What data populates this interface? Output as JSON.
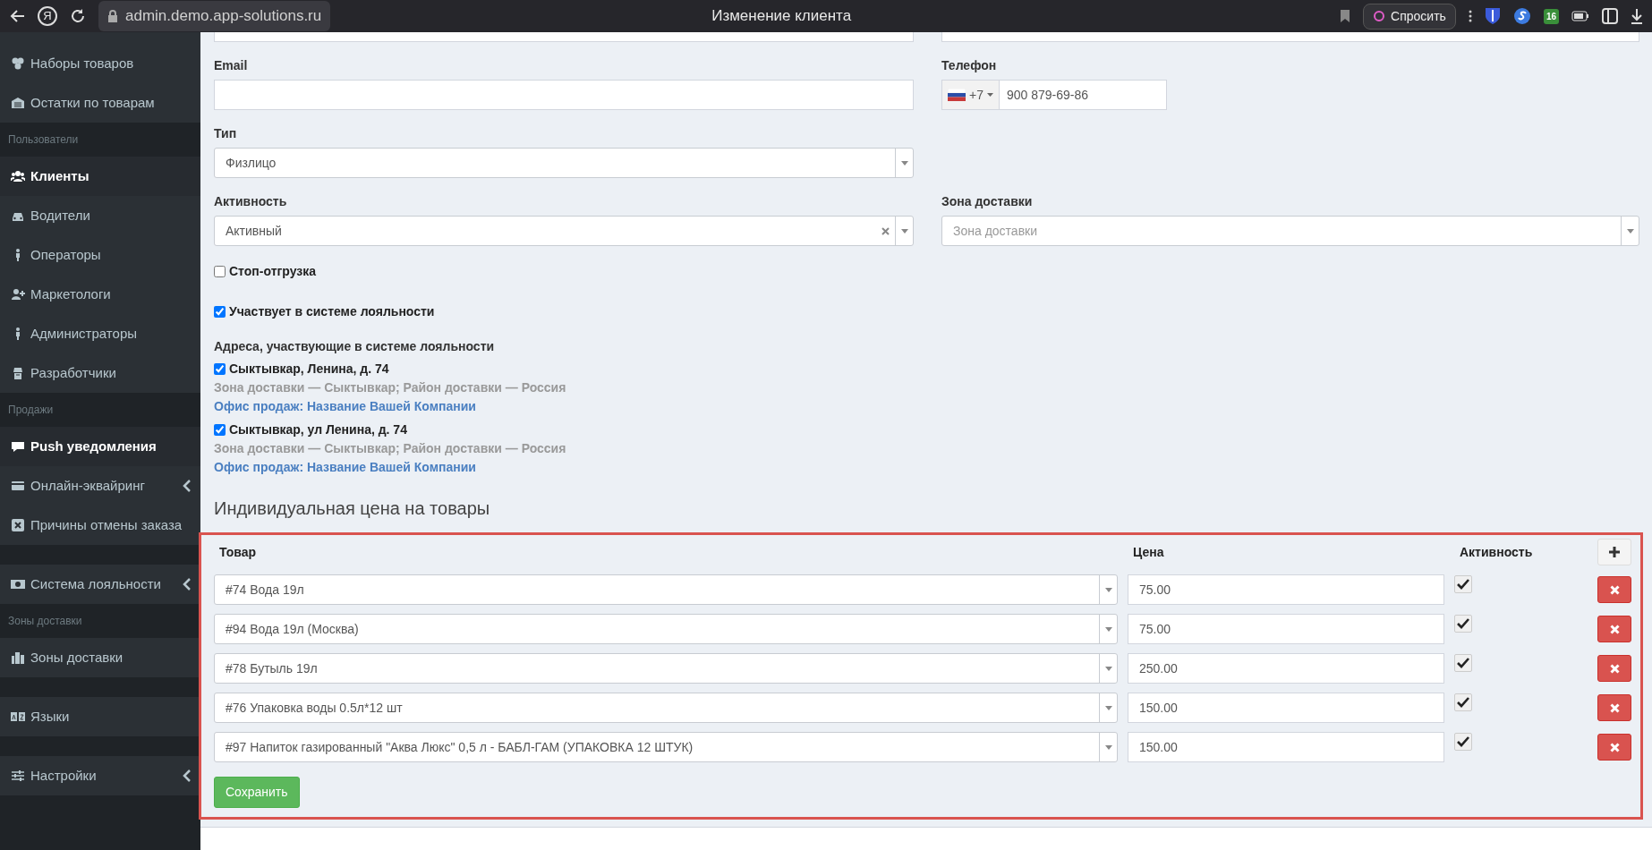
{
  "browser": {
    "logo_letter": "Я",
    "url": "admin.demo.app-solutions.ru",
    "title": "Изменение клиента",
    "ask_button": "Спросить",
    "extension_badge": "16"
  },
  "sidebar": {
    "items": [
      {
        "kind": "item",
        "label": "Наборы товаров",
        "selected": false,
        "has_submenu": false
      },
      {
        "kind": "item",
        "label": "Остатки по товарам",
        "selected": false,
        "has_submenu": false
      },
      {
        "kind": "header",
        "label": "Пользователи"
      },
      {
        "kind": "item",
        "label": "Клиенты",
        "selected": true,
        "has_submenu": false
      },
      {
        "kind": "item",
        "label": "Водители",
        "selected": false,
        "has_submenu": false
      },
      {
        "kind": "item",
        "label": "Операторы",
        "selected": false,
        "has_submenu": false
      },
      {
        "kind": "item",
        "label": "Маркетологи",
        "selected": false,
        "has_submenu": false
      },
      {
        "kind": "item",
        "label": "Администраторы",
        "selected": false,
        "has_submenu": false
      },
      {
        "kind": "item",
        "label": "Разработчики",
        "selected": false,
        "has_submenu": false
      },
      {
        "kind": "header",
        "label": "Продажи"
      },
      {
        "kind": "item",
        "label": "Push уведомления",
        "selected": true,
        "has_submenu": false
      },
      {
        "kind": "item",
        "label": "Онлайн-эквайринг",
        "selected": false,
        "has_submenu": true
      },
      {
        "kind": "item",
        "label": "Причины отмены заказа",
        "selected": false,
        "has_submenu": false
      },
      {
        "kind": "spacer"
      },
      {
        "kind": "item",
        "label": "Система лояльности",
        "selected": false,
        "has_submenu": true
      },
      {
        "kind": "header",
        "label": "Зоны доставки"
      },
      {
        "kind": "item",
        "label": "Зоны доставки",
        "selected": false,
        "has_submenu": false
      },
      {
        "kind": "spacer"
      },
      {
        "kind": "item",
        "label": "Языки",
        "selected": false,
        "has_submenu": false
      },
      {
        "kind": "spacer"
      },
      {
        "kind": "item",
        "label": "Настройки",
        "selected": false,
        "has_submenu": true
      }
    ]
  },
  "form": {
    "email": {
      "label": "Email"
    },
    "phone": {
      "label": "Телефон",
      "country_code": "+7",
      "value": "900 879-69-86"
    },
    "type": {
      "label": "Тип",
      "value": "Физлицо"
    },
    "activity": {
      "label": "Активность",
      "value": "Активный",
      "clearable": true
    },
    "delivery_zone": {
      "label": "Зона доставки",
      "placeholder": "Зона доставки"
    },
    "checkboxes": [
      {
        "label": "Стоп-отгрузка",
        "checked": false
      },
      {
        "label": "Участвует в системе лояльности",
        "checked": true
      }
    ],
    "loyalty_addresses": {
      "title": "Адреса, участвующие в системе лояльности",
      "items": [
        {
          "address": "Сыктывкар, Ленина, д. 74",
          "checked": true,
          "details": "Зона доставки — Сыктывкар; Район доставки — Россия",
          "office_link": "Офис продаж: Название Вашей Компании"
        },
        {
          "address": "Сыктывкар, ул Ленина, д. 74",
          "checked": true,
          "details": "Зона доставки — Сыктывкар; Район доставки — Россия",
          "office_link": "Офис продаж: Название Вашей Компании"
        }
      ]
    }
  },
  "individual_prices": {
    "title": "Индивидуальная цена на товары",
    "highlighted": true,
    "columns": [
      "Товар",
      "Цена",
      "Активность"
    ],
    "rows": [
      {
        "product": "#74 Вода 19л",
        "price": "75.00",
        "active": true
      },
      {
        "product": "#94 Вода 19л (Москва)",
        "price": "75.00",
        "active": true
      },
      {
        "product": "#78 Бутыль 19л",
        "price": "250.00",
        "active": true
      },
      {
        "product": "#76 Упаковка воды 0.5л*12 шт",
        "price": "150.00",
        "active": true
      },
      {
        "product": "#97 Напиток газированный \"Аква Люкс\" 0,5 л - БАБЛ-ГАМ (УПАКОВКА 12 ШТУК)",
        "price": "150.00",
        "active": true
      }
    ],
    "save_button": "Сохранить"
  }
}
